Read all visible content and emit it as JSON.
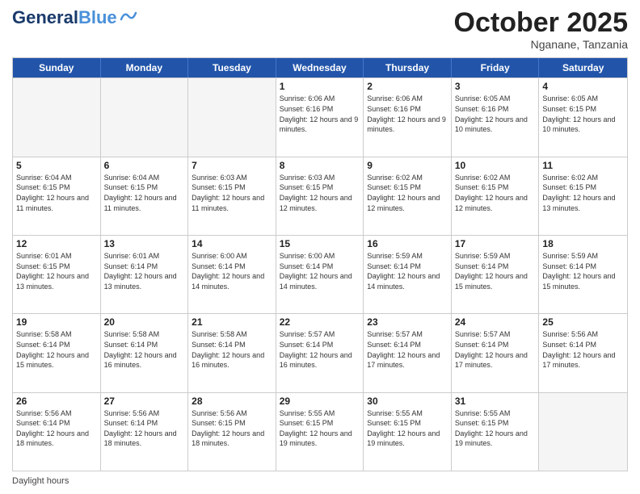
{
  "header": {
    "logo_line1": "General",
    "logo_line2": "Blue",
    "month": "October 2025",
    "location": "Nganane, Tanzania"
  },
  "days_of_week": [
    "Sunday",
    "Monday",
    "Tuesday",
    "Wednesday",
    "Thursday",
    "Friday",
    "Saturday"
  ],
  "weeks": [
    [
      {
        "day": "",
        "empty": true
      },
      {
        "day": "",
        "empty": true
      },
      {
        "day": "",
        "empty": true
      },
      {
        "day": "1",
        "sunrise": "Sunrise: 6:06 AM",
        "sunset": "Sunset: 6:16 PM",
        "daylight": "Daylight: 12 hours and 9 minutes."
      },
      {
        "day": "2",
        "sunrise": "Sunrise: 6:06 AM",
        "sunset": "Sunset: 6:16 PM",
        "daylight": "Daylight: 12 hours and 9 minutes."
      },
      {
        "day": "3",
        "sunrise": "Sunrise: 6:05 AM",
        "sunset": "Sunset: 6:16 PM",
        "daylight": "Daylight: 12 hours and 10 minutes."
      },
      {
        "day": "4",
        "sunrise": "Sunrise: 6:05 AM",
        "sunset": "Sunset: 6:15 PM",
        "daylight": "Daylight: 12 hours and 10 minutes."
      }
    ],
    [
      {
        "day": "5",
        "sunrise": "Sunrise: 6:04 AM",
        "sunset": "Sunset: 6:15 PM",
        "daylight": "Daylight: 12 hours and 11 minutes."
      },
      {
        "day": "6",
        "sunrise": "Sunrise: 6:04 AM",
        "sunset": "Sunset: 6:15 PM",
        "daylight": "Daylight: 12 hours and 11 minutes."
      },
      {
        "day": "7",
        "sunrise": "Sunrise: 6:03 AM",
        "sunset": "Sunset: 6:15 PM",
        "daylight": "Daylight: 12 hours and 11 minutes."
      },
      {
        "day": "8",
        "sunrise": "Sunrise: 6:03 AM",
        "sunset": "Sunset: 6:15 PM",
        "daylight": "Daylight: 12 hours and 12 minutes."
      },
      {
        "day": "9",
        "sunrise": "Sunrise: 6:02 AM",
        "sunset": "Sunset: 6:15 PM",
        "daylight": "Daylight: 12 hours and 12 minutes."
      },
      {
        "day": "10",
        "sunrise": "Sunrise: 6:02 AM",
        "sunset": "Sunset: 6:15 PM",
        "daylight": "Daylight: 12 hours and 12 minutes."
      },
      {
        "day": "11",
        "sunrise": "Sunrise: 6:02 AM",
        "sunset": "Sunset: 6:15 PM",
        "daylight": "Daylight: 12 hours and 13 minutes."
      }
    ],
    [
      {
        "day": "12",
        "sunrise": "Sunrise: 6:01 AM",
        "sunset": "Sunset: 6:15 PM",
        "daylight": "Daylight: 12 hours and 13 minutes."
      },
      {
        "day": "13",
        "sunrise": "Sunrise: 6:01 AM",
        "sunset": "Sunset: 6:14 PM",
        "daylight": "Daylight: 12 hours and 13 minutes."
      },
      {
        "day": "14",
        "sunrise": "Sunrise: 6:00 AM",
        "sunset": "Sunset: 6:14 PM",
        "daylight": "Daylight: 12 hours and 14 minutes."
      },
      {
        "day": "15",
        "sunrise": "Sunrise: 6:00 AM",
        "sunset": "Sunset: 6:14 PM",
        "daylight": "Daylight: 12 hours and 14 minutes."
      },
      {
        "day": "16",
        "sunrise": "Sunrise: 5:59 AM",
        "sunset": "Sunset: 6:14 PM",
        "daylight": "Daylight: 12 hours and 14 minutes."
      },
      {
        "day": "17",
        "sunrise": "Sunrise: 5:59 AM",
        "sunset": "Sunset: 6:14 PM",
        "daylight": "Daylight: 12 hours and 15 minutes."
      },
      {
        "day": "18",
        "sunrise": "Sunrise: 5:59 AM",
        "sunset": "Sunset: 6:14 PM",
        "daylight": "Daylight: 12 hours and 15 minutes."
      }
    ],
    [
      {
        "day": "19",
        "sunrise": "Sunrise: 5:58 AM",
        "sunset": "Sunset: 6:14 PM",
        "daylight": "Daylight: 12 hours and 15 minutes."
      },
      {
        "day": "20",
        "sunrise": "Sunrise: 5:58 AM",
        "sunset": "Sunset: 6:14 PM",
        "daylight": "Daylight: 12 hours and 16 minutes."
      },
      {
        "day": "21",
        "sunrise": "Sunrise: 5:58 AM",
        "sunset": "Sunset: 6:14 PM",
        "daylight": "Daylight: 12 hours and 16 minutes."
      },
      {
        "day": "22",
        "sunrise": "Sunrise: 5:57 AM",
        "sunset": "Sunset: 6:14 PM",
        "daylight": "Daylight: 12 hours and 16 minutes."
      },
      {
        "day": "23",
        "sunrise": "Sunrise: 5:57 AM",
        "sunset": "Sunset: 6:14 PM",
        "daylight": "Daylight: 12 hours and 17 minutes."
      },
      {
        "day": "24",
        "sunrise": "Sunrise: 5:57 AM",
        "sunset": "Sunset: 6:14 PM",
        "daylight": "Daylight: 12 hours and 17 minutes."
      },
      {
        "day": "25",
        "sunrise": "Sunrise: 5:56 AM",
        "sunset": "Sunset: 6:14 PM",
        "daylight": "Daylight: 12 hours and 17 minutes."
      }
    ],
    [
      {
        "day": "26",
        "sunrise": "Sunrise: 5:56 AM",
        "sunset": "Sunset: 6:14 PM",
        "daylight": "Daylight: 12 hours and 18 minutes."
      },
      {
        "day": "27",
        "sunrise": "Sunrise: 5:56 AM",
        "sunset": "Sunset: 6:14 PM",
        "daylight": "Daylight: 12 hours and 18 minutes."
      },
      {
        "day": "28",
        "sunrise": "Sunrise: 5:56 AM",
        "sunset": "Sunset: 6:15 PM",
        "daylight": "Daylight: 12 hours and 18 minutes."
      },
      {
        "day": "29",
        "sunrise": "Sunrise: 5:55 AM",
        "sunset": "Sunset: 6:15 PM",
        "daylight": "Daylight: 12 hours and 19 minutes."
      },
      {
        "day": "30",
        "sunrise": "Sunrise: 5:55 AM",
        "sunset": "Sunset: 6:15 PM",
        "daylight": "Daylight: 12 hours and 19 minutes."
      },
      {
        "day": "31",
        "sunrise": "Sunrise: 5:55 AM",
        "sunset": "Sunset: 6:15 PM",
        "daylight": "Daylight: 12 hours and 19 minutes."
      },
      {
        "day": "",
        "empty": true
      }
    ]
  ],
  "footer": {
    "daylight_label": "Daylight hours"
  }
}
